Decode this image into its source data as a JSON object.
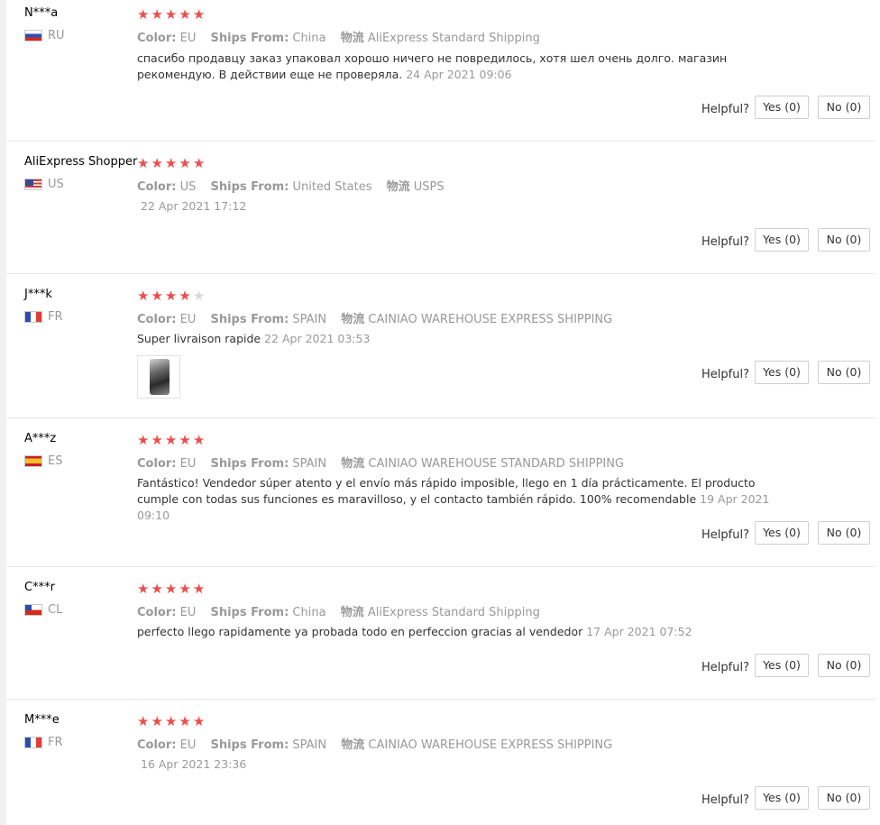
{
  "labels": {
    "color": "Color:",
    "ships_from": "Ships From:",
    "logistics": "物流",
    "helpful": "Helpful?"
  },
  "colors": {
    "star": "#ee4c4c",
    "star_empty": "#d9d9d9",
    "meta_text": "#999999"
  },
  "reviews": [
    {
      "user": "N***a",
      "country": "RU",
      "flag": "flag-ru-icon",
      "rating": 5,
      "color": "EU",
      "ships_from": "China",
      "shipping": "AliExpress Standard Shipping",
      "text": "спасибо продавцу заказ упаковал хорошо ничего не повредилось, хотя шел очень долго. магазин рекомендую. В действии еще не проверяла.",
      "date": "24 Apr 2021 09:06",
      "yes": "Yes (0)",
      "no": "No (0)"
    },
    {
      "user": "AliExpress Shopper",
      "country": "US",
      "flag": "flag-us-icon",
      "rating": 5,
      "color": "US",
      "ships_from": "United States",
      "shipping": "USPS",
      "text": "",
      "date": "22 Apr 2021 17:12",
      "yes": "Yes (0)",
      "no": "No (0)"
    },
    {
      "user": "J***k",
      "country": "FR",
      "flag": "flag-fr-icon",
      "rating": 4,
      "color": "EU",
      "ships_from": "SPAIN",
      "shipping": "CAINIAO WAREHOUSE EXPRESS SHIPPING",
      "text": "Super livraison rapide",
      "date": "22 Apr 2021 03:53",
      "photo": "review-photo-thumbnail",
      "yes": "Yes (0)",
      "no": "No (0)"
    },
    {
      "user": "A***z",
      "country": "ES",
      "flag": "flag-es-icon",
      "rating": 5,
      "color": "EU",
      "ships_from": "SPAIN",
      "shipping": "CAINIAO WAREHOUSE STANDARD SHIPPING",
      "text": "Fantástico! Vendedor súper atento y el envío más rápido imposible, llego en 1 día prácticamente. El producto cumple con todas sus funciones es maravilloso, y el contacto también rápido. 100% recomendable",
      "date": "19 Apr 2021 09:10",
      "yes": "Yes (0)",
      "no": "No (0)"
    },
    {
      "user": "C***r",
      "country": "CL",
      "flag": "flag-cl-icon",
      "rating": 5,
      "color": "EU",
      "ships_from": "China",
      "shipping": "AliExpress Standard Shipping",
      "text": "perfecto llego rapidamente ya probada todo en perfeccion gracias al vendedor",
      "date": "17 Apr 2021 07:52",
      "yes": "Yes (0)",
      "no": "No (0)"
    },
    {
      "user": "M***e",
      "country": "FR",
      "flag": "flag-fr-icon",
      "rating": 5,
      "color": "EU",
      "ships_from": "SPAIN",
      "shipping": "CAINIAO WAREHOUSE EXPRESS SHIPPING",
      "text": "",
      "date": "16 Apr 2021 23:36",
      "yes": "Yes (0)",
      "no": "No (0)"
    }
  ]
}
